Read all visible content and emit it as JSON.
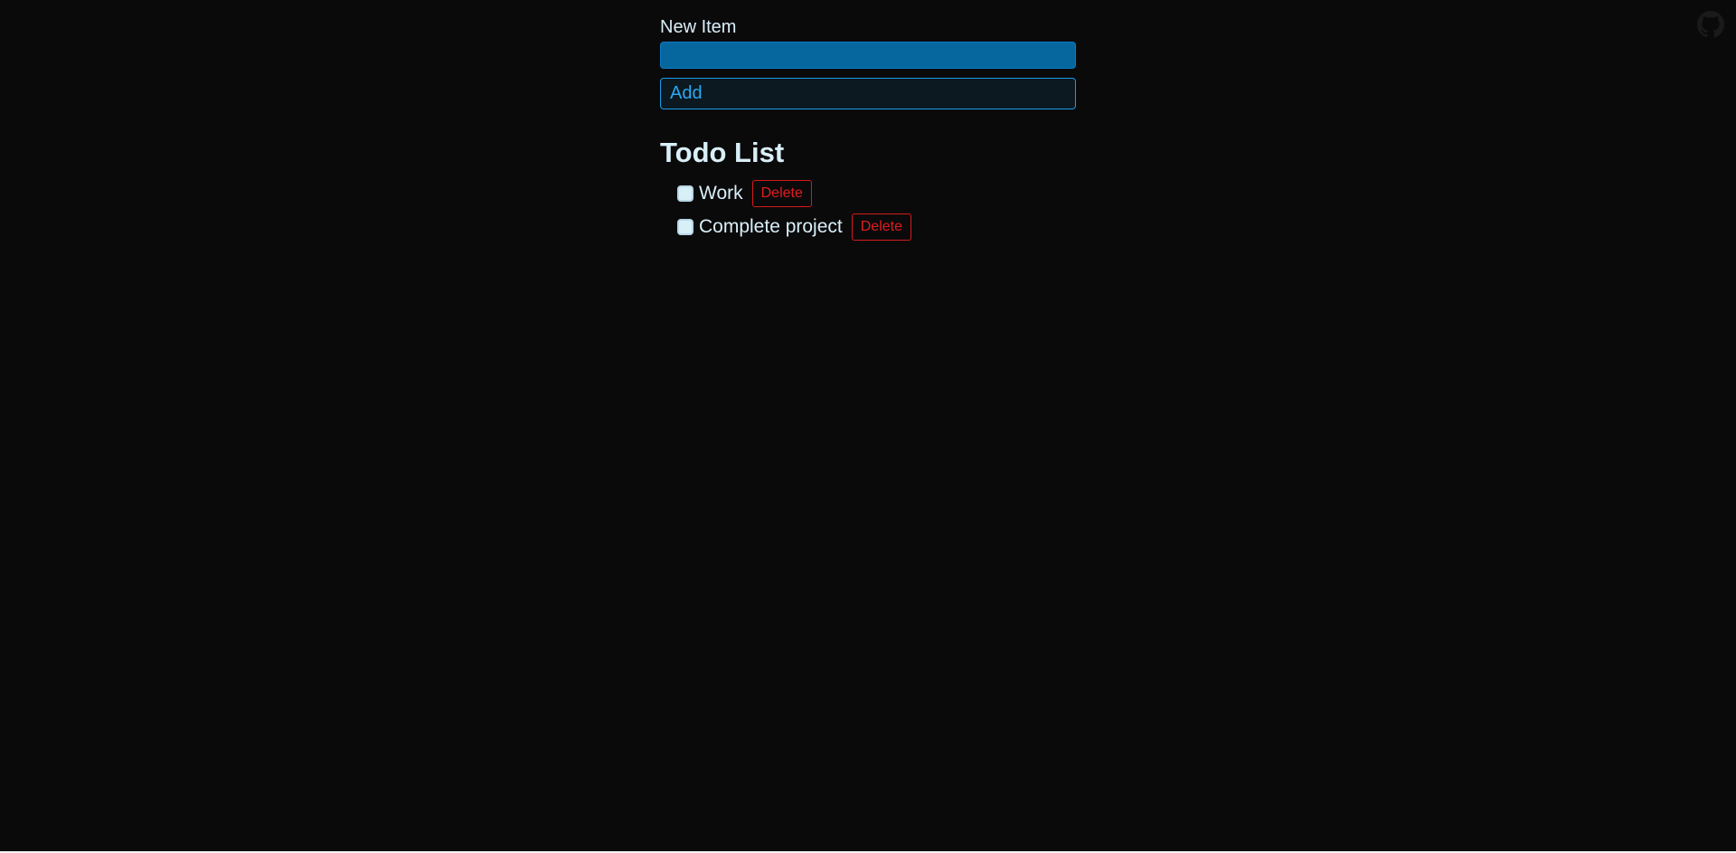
{
  "form": {
    "label": "New Item",
    "input_value": "",
    "add_label": "Add"
  },
  "todo": {
    "title": "Todo List",
    "items": [
      {
        "text": "Work",
        "checked": false,
        "delete_label": "Delete"
      },
      {
        "text": "Complete project",
        "checked": false,
        "delete_label": "Delete"
      }
    ]
  },
  "github": {
    "icon": "github-icon"
  },
  "colors": {
    "background": "#0b0a0b",
    "text": "#d9eff8",
    "accent": "#05679e",
    "danger": "#e11d1d"
  }
}
